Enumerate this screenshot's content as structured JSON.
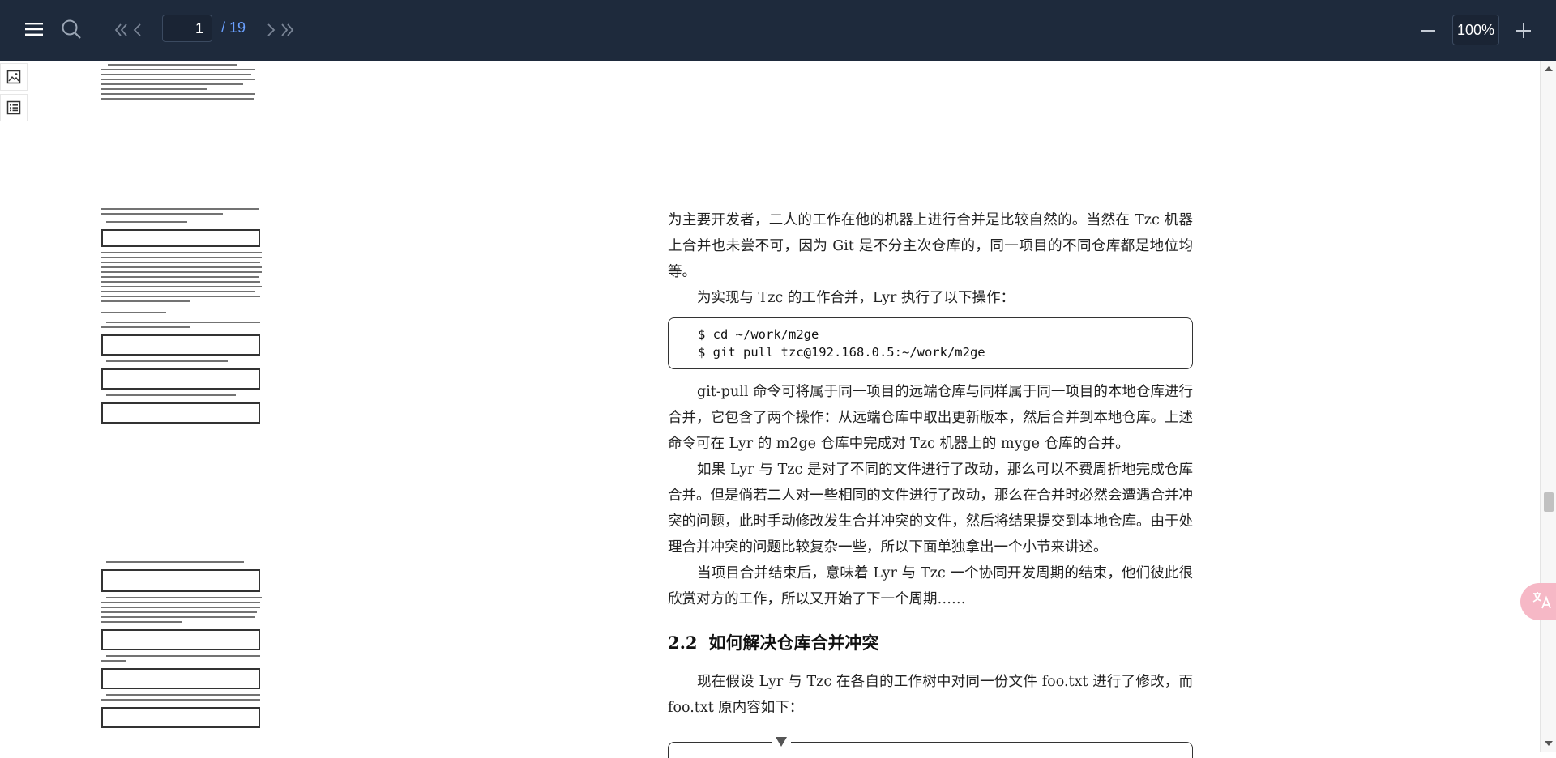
{
  "toolbar": {
    "current_page": "1",
    "total_pages": "/ 19",
    "zoom": "100%"
  },
  "document": {
    "paragraphs": [
      "为主要开发者，二人的工作在他的机器上进行合并是比较自然的。当然在 Tzc 机器上合并也未尝不可，因为 Git 是不分主次仓库的，同一项目的不同仓库都是地位均等。",
      "为实现与 Tzc 的工作合并，Lyr 执行了以下操作：",
      "git-pull 命令可将属于同一项目的远端仓库与同样属于同一项目的本地仓库进行合并，它包含了两个操作：从远端仓库中取出更新版本，然后合并到本地仓库。上述命令可在 Lyr 的 m2ge 仓库中完成对 Tzc 机器上的 myge 仓库的合并。",
      "如果 Lyr 与 Tzc 是对了不同的文件进行了改动，那么可以不费周折地完成仓库合并。但是倘若二人对一些相同的文件进行了改动，那么在合并时必然会遭遇合并冲突的问题，此时手动修改发生合并冲突的文件，然后将结果提交到本地仓库。由于处理合并冲突的问题比较复杂一些，所以下面单独拿出一个小节来讲述。",
      "当项目合并结束后，意味着 Lyr 与 Tzc 一个协同开发周期的结束，他们彼此很欣赏对方的工作，所以又开始了下一个周期……",
      "现在假设 Lyr 与 Tzc 在各自的工作树中对同一份文件 foo.txt 进行了修改，而 foo.txt 原内容如下："
    ],
    "code_lines": [
      "$ cd ~/work/m2ge",
      "$ git pull tzc@192.168.0.5:~/work/m2ge"
    ],
    "section": {
      "number": "2.2",
      "title": "如何解决仓库合并冲突"
    }
  },
  "icons": {
    "menu": "menu-icon",
    "search": "search-icon",
    "first_page": "double-chevron-left-icon",
    "prev_page": "chevron-left-icon",
    "next_page": "chevron-right-icon",
    "last_page": "double-chevron-right-icon",
    "zoom_out": "minus-icon",
    "zoom_in": "plus-icon",
    "thumbnails": "image-icon",
    "outline": "list-icon",
    "translate": "translate-icon"
  },
  "colors": {
    "toolbar_bg": "#1e2a3c",
    "page_total": "#6aa0ff",
    "translate_fab": "#f6b8c6"
  }
}
